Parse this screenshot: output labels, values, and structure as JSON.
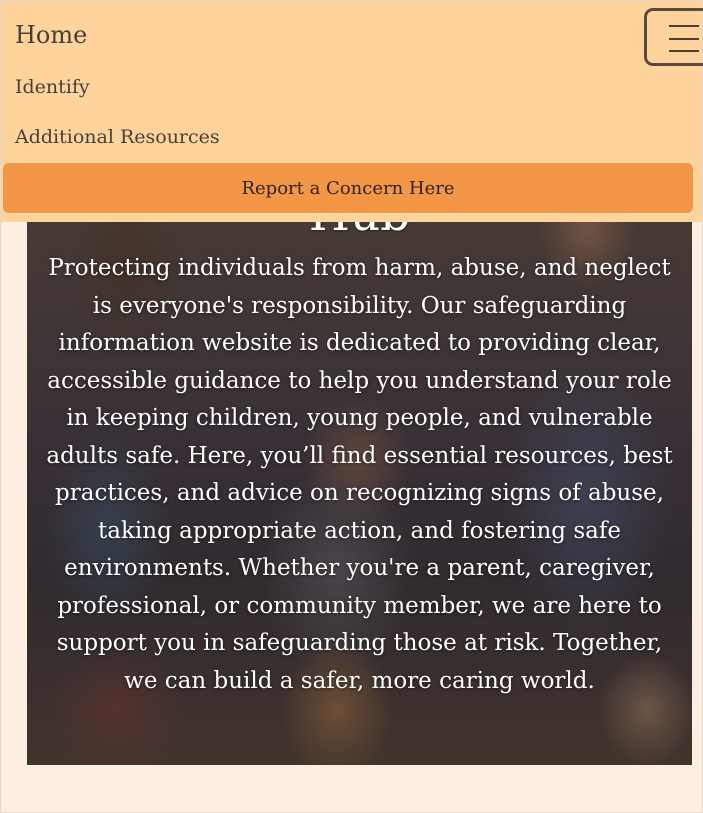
{
  "nav": {
    "home": "Home",
    "identify": "Identify",
    "resources": "Additional Resources",
    "report_button": "Report a Concern Here",
    "menu_icon": "hamburger-menu-icon"
  },
  "hero": {
    "title_visible": "Hub",
    "body": "Protecting individuals from harm, abuse, and neglect is everyone's responsibility. Our safeguarding information website is dedicated to providing clear, accessible guidance to help you understand your role in keeping children, young people, and vulnerable adults safe. Here, you’ll find essential resources, best practices, and advice on recognizing signs of abuse, taking appropriate action, and fostering safe environments. Whether you're a parent, caregiver, professional, or community member, we are here to support you in safeguarding those at risk. Together, we can build a safer, more caring world."
  },
  "colors": {
    "nav_bg": "#fed39c",
    "button_bg": "#f39747",
    "page_bg": "#fdeee2",
    "text_dark": "#4a3f38"
  }
}
